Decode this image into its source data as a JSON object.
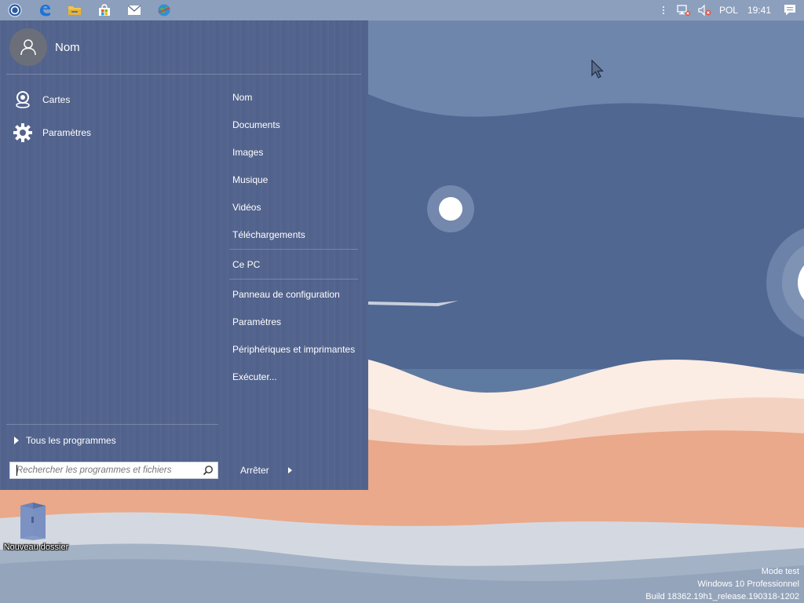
{
  "taskbar": {
    "apps": [
      {
        "name": "start-orb-icon"
      },
      {
        "name": "edge-icon"
      },
      {
        "name": "file-explorer-icon"
      },
      {
        "name": "store-icon"
      },
      {
        "name": "mail-icon"
      },
      {
        "name": "globe-app-icon"
      }
    ],
    "tray": {
      "language": "POL",
      "time": "19:41"
    }
  },
  "start_menu": {
    "user_name": "Nom",
    "pinned": [
      {
        "label": "Cartes",
        "icon": "maps-icon"
      },
      {
        "label": "Paramètres",
        "icon": "gear-icon"
      }
    ],
    "places": [
      {
        "label": "Nom"
      },
      {
        "label": "Documents"
      },
      {
        "label": "Images"
      },
      {
        "label": "Musique"
      },
      {
        "label": "Vidéos"
      },
      {
        "label": "Téléchargements"
      },
      {
        "label": "Ce PC"
      },
      {
        "label": "Panneau de configuration"
      },
      {
        "label": "Paramètres"
      },
      {
        "label": "Périphériques et imprimantes"
      },
      {
        "label": "Exécuter..."
      }
    ],
    "all_programs": "Tous les programmes",
    "search_placeholder": "Rechercher les programmes et fichiers",
    "shutdown_label": "Arrêter"
  },
  "desktop": {
    "icons": [
      {
        "label": "Nouveau dossier",
        "icon": "folder-icon"
      }
    ],
    "watermark": {
      "line1": "Mode test",
      "line2": "Windows 10 Professionnel",
      "line3": "Build 18362.19h1_release.190318-1202"
    }
  },
  "colors": {
    "start_menu_bg": "#52638d",
    "taskbar_bg": "#8c9fbd",
    "sky": "#566f97",
    "sand_light": "#f5ddd0",
    "sand_dark": "#eaa98a"
  }
}
